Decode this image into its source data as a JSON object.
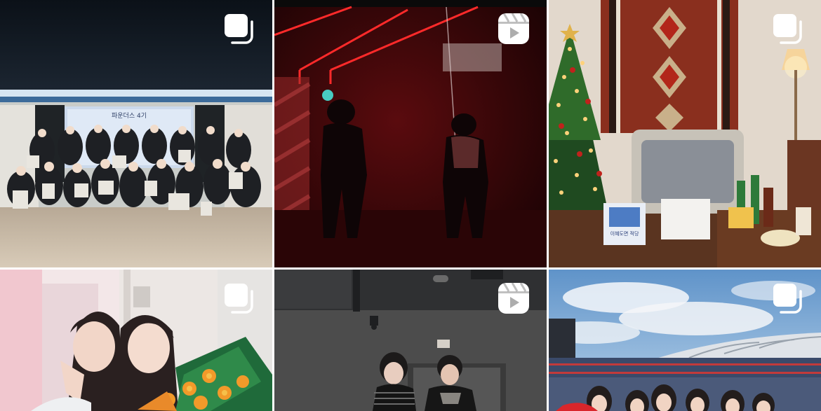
{
  "feed": {
    "posts": [
      {
        "type": "carousel",
        "icon": "carousel-icon",
        "screen_text": "파운더스 4기"
      },
      {
        "type": "reel",
        "icon": "reels-icon"
      },
      {
        "type": "carousel",
        "icon": "carousel-icon",
        "screen_text": "이혜도면 적당"
      },
      {
        "type": "carousel",
        "icon": "carousel-icon"
      },
      {
        "type": "reel",
        "icon": "reels-icon"
      },
      {
        "type": "carousel",
        "icon": "carousel-icon"
      }
    ]
  },
  "colors": {
    "badge": "#ffffff",
    "background": "#ffffff"
  }
}
